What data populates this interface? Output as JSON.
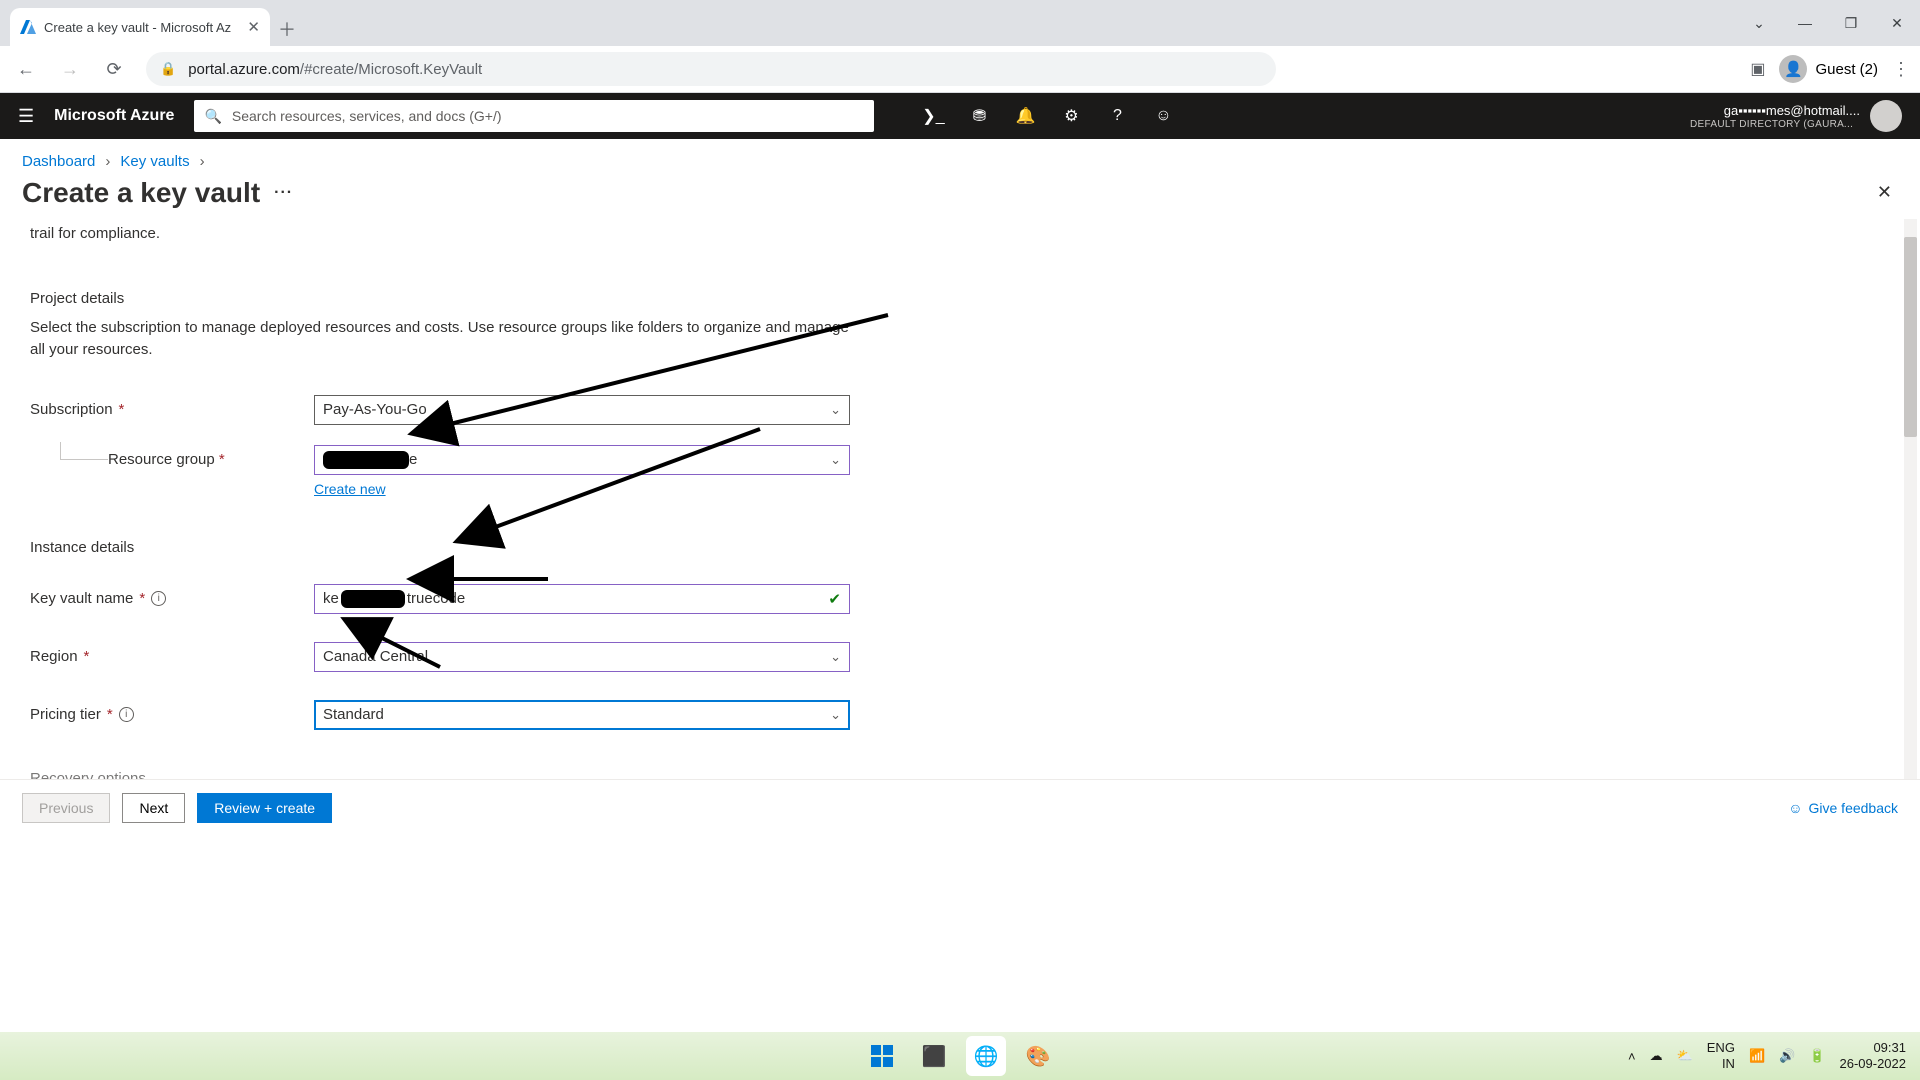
{
  "browser": {
    "tab_title": "Create a key vault - Microsoft Az",
    "url_host": "portal.azure.com",
    "url_path": "/#create/Microsoft.KeyVault",
    "guest_label": "Guest (2)"
  },
  "azure": {
    "brand": "Microsoft Azure",
    "search_placeholder": "Search resources, services, and docs (G+/)",
    "account_email": "ga▪▪▪▪▪▪mes@hotmail....",
    "account_dir": "DEFAULT DIRECTORY (GAURAVC..."
  },
  "crumbs": {
    "dashboard": "Dashboard",
    "keyvaults": "Key vaults"
  },
  "page": {
    "title": "Create a key vault",
    "intro_tail": "trail for compliance.",
    "project_h": "Project details",
    "project_p": "Select the subscription to manage deployed resources and costs. Use resource groups like folders to organize and manage all your resources.",
    "subscription_label": "Subscription",
    "subscription_value": "Pay-As-You-Go",
    "rg_label": "Resource group",
    "rg_value_visible_suffix": "e",
    "create_new": "Create new",
    "instance_h": "Instance details",
    "name_label": "Key vault name",
    "name_prefix": "ke",
    "name_suffix": "truecode",
    "region_label": "Region",
    "region_value": "Canada Central",
    "tier_label": "Pricing tier",
    "tier_value": "Standard",
    "recovery_h": "Recovery options"
  },
  "footer": {
    "prev": "Previous",
    "next": "Next",
    "review": "Review + create",
    "feedback": "Give feedback"
  },
  "taskbar": {
    "lang1": "ENG",
    "lang2": "IN",
    "time": "09:31",
    "date": "26-09-2022"
  }
}
